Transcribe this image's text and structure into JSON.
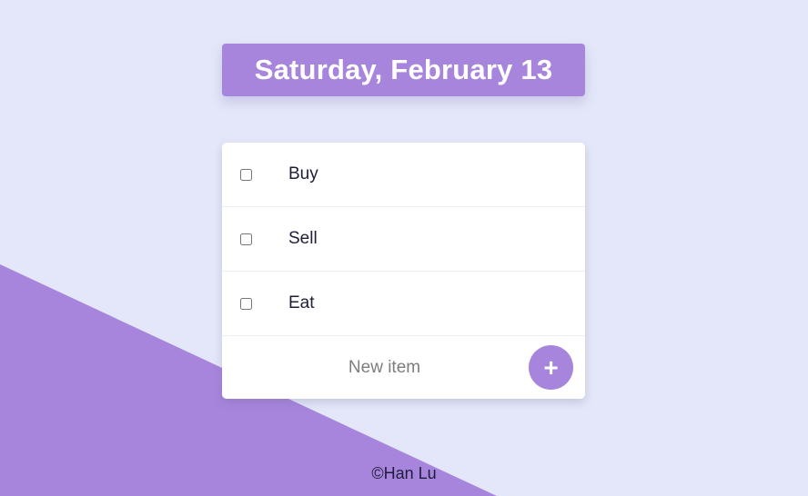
{
  "colors": {
    "background": "#e3e7f9",
    "accent": "#a785dc"
  },
  "header": {
    "date": "Saturday, February 13"
  },
  "todo_list": {
    "items": [
      {
        "label": "Buy",
        "checked": false
      },
      {
        "label": "Sell",
        "checked": false
      },
      {
        "label": "Eat",
        "checked": false
      }
    ],
    "new_item_placeholder": "New item",
    "add_button_label": "+"
  },
  "footer": {
    "text": "©Han Lu"
  }
}
